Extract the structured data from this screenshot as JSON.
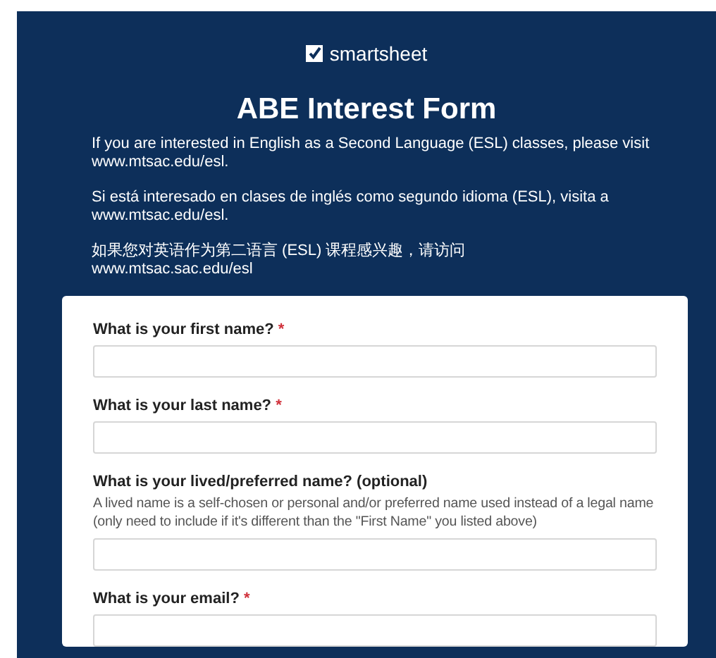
{
  "header": {
    "logo_text": "smartsheet",
    "title": "ABE Interest Form",
    "paragraphs": [
      "If you are interested in English as a Second Language (ESL) classes, please visit www.mtsac.edu/esl.",
      "Si está interesado en clases de inglés como segundo idioma (ESL), visita a www.mtsac.edu/esl.",
      "如果您对英语作为第二语言 (ESL) 课程感兴趣，请访问\nwww.mtsac.sac.edu/esl"
    ]
  },
  "fields": [
    {
      "label": "What is your first name?",
      "required_mark": "*"
    },
    {
      "label": "What is your last name?",
      "required_mark": "*"
    },
    {
      "label": "What is your lived/preferred name? (optional)",
      "description": "A lived name is a self-chosen or personal and/or preferred name used instead of a legal name (only need to include if it's different than the \"First Name\" you listed above)"
    },
    {
      "label": "What is your email?",
      "required_mark": "*"
    }
  ]
}
